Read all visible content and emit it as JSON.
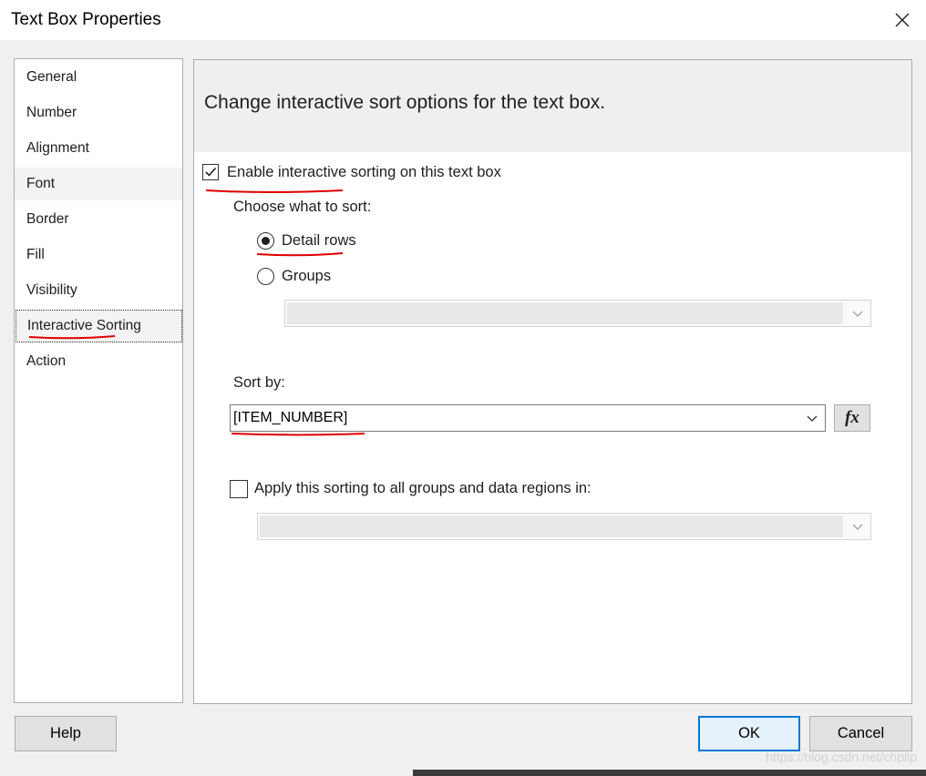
{
  "window": {
    "title": "Text Box Properties"
  },
  "nav": {
    "items": [
      {
        "label": "General"
      },
      {
        "label": "Number"
      },
      {
        "label": "Alignment"
      },
      {
        "label": "Font"
      },
      {
        "label": "Border"
      },
      {
        "label": "Fill"
      },
      {
        "label": "Visibility"
      },
      {
        "label": "Interactive Sorting"
      },
      {
        "label": "Action"
      }
    ],
    "selected": "Interactive Sorting",
    "hovered": "Font"
  },
  "panel": {
    "header": "Change interactive sort options for the text box.",
    "enable_checkbox": {
      "label": "Enable interactive sorting on this text box",
      "checked": true
    },
    "choose_label": "Choose what to sort:",
    "radio_detail": {
      "label": "Detail rows",
      "selected": true
    },
    "radio_groups": {
      "label": "Groups",
      "selected": false
    },
    "groups_combo": {
      "value": ""
    },
    "sort_by_label": "Sort by:",
    "sort_by_combo": {
      "value": "[ITEM_NUMBER]"
    },
    "fx_button": {
      "label": "fx"
    },
    "apply_checkbox": {
      "label": "Apply this sorting to all groups and data regions in:",
      "checked": false
    },
    "apply_combo": {
      "value": ""
    }
  },
  "buttons": {
    "help": "Help",
    "ok": "OK",
    "cancel": "Cancel"
  },
  "annotation_color": "#e00000",
  "watermark": "https://blog.csdn.net/chplip"
}
